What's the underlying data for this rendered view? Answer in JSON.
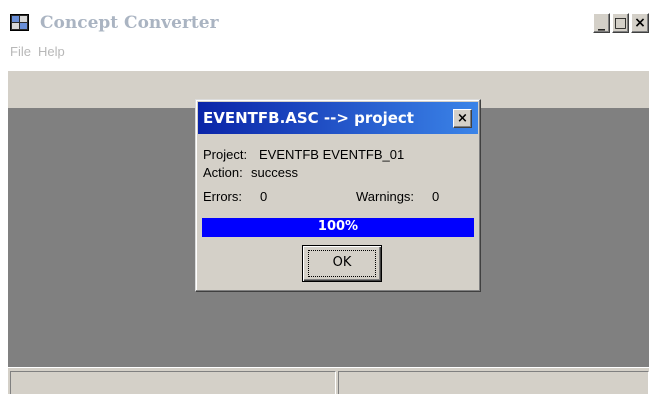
{
  "window": {
    "title": "Concept Converter",
    "app_icon": "concept-app-icon",
    "minimize_glyph": "_",
    "maximize_glyph": "□",
    "close_glyph": "×"
  },
  "menu": {
    "items": [
      {
        "label": "File"
      },
      {
        "label": "Help"
      }
    ]
  },
  "dialog": {
    "title": "EVENTFB.ASC --> project",
    "close_glyph": "×",
    "project_label": "Project:",
    "project_value": "EVENTFB  EVENTFB_01",
    "action_label": "Action:",
    "action_value": "success",
    "errors_label": "Errors:",
    "errors_value": "0",
    "warnings_label": "Warnings:",
    "warnings_value": "0",
    "progress": {
      "value": 1.0,
      "text": "100%"
    },
    "ok_label": "OK"
  },
  "colors": {
    "dialog_title_start": "#0a24a8",
    "dialog_title_end": "#3b84e8",
    "progress_fill": "#0000ff",
    "client_background": "#808080",
    "chrome": "#d4d0c8"
  }
}
